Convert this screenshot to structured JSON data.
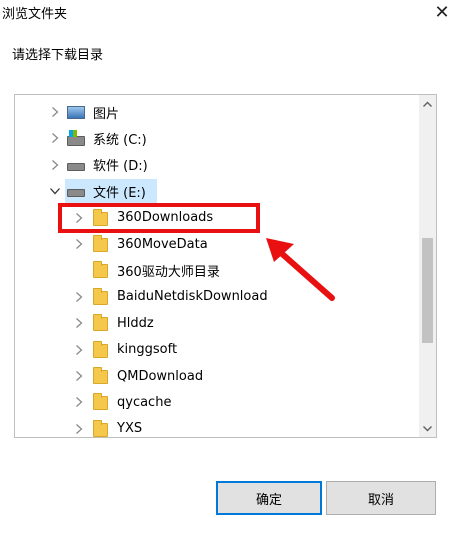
{
  "window": {
    "title": "浏览文件夹",
    "close_glyph": "✕"
  },
  "prompt": "请选择下载目录",
  "tree": [
    {
      "label": "图片",
      "icon": "pictures-icon",
      "level": 1,
      "expander": "collapsed"
    },
    {
      "label": "系统 (C:)",
      "icon": "system-drive-icon",
      "level": 1,
      "expander": "collapsed"
    },
    {
      "label": "软件 (D:)",
      "icon": "drive-icon",
      "level": 1,
      "expander": "collapsed"
    },
    {
      "label": "文件 (E:)",
      "icon": "drive-icon",
      "level": 1,
      "expander": "expanded",
      "selected": true
    },
    {
      "label": "360Downloads",
      "icon": "folder-icon",
      "level": 2,
      "expander": "collapsed"
    },
    {
      "label": "360MoveData",
      "icon": "folder-icon",
      "level": 2,
      "expander": "collapsed"
    },
    {
      "label": "360驱动大师目录",
      "icon": "folder-icon",
      "level": 2,
      "expander": "none"
    },
    {
      "label": "BaiduNetdiskDownload",
      "icon": "folder-icon",
      "level": 2,
      "expander": "collapsed"
    },
    {
      "label": "Hlddz",
      "icon": "folder-icon",
      "level": 2,
      "expander": "collapsed"
    },
    {
      "label": "kinggsoft",
      "icon": "folder-icon",
      "level": 2,
      "expander": "collapsed"
    },
    {
      "label": "QMDownload",
      "icon": "folder-icon",
      "level": 2,
      "expander": "collapsed"
    },
    {
      "label": "qycache",
      "icon": "folder-icon",
      "level": 2,
      "expander": "collapsed"
    },
    {
      "label": "YXS",
      "icon": "folder-icon",
      "level": 2,
      "expander": "collapsed"
    }
  ],
  "buttons": {
    "ok": "确定",
    "cancel": "取消"
  },
  "annotation": {
    "color": "#e81010",
    "target": "360Downloads"
  },
  "colors": {
    "selection": "#cce8ff",
    "focus_border": "#0078d7"
  }
}
